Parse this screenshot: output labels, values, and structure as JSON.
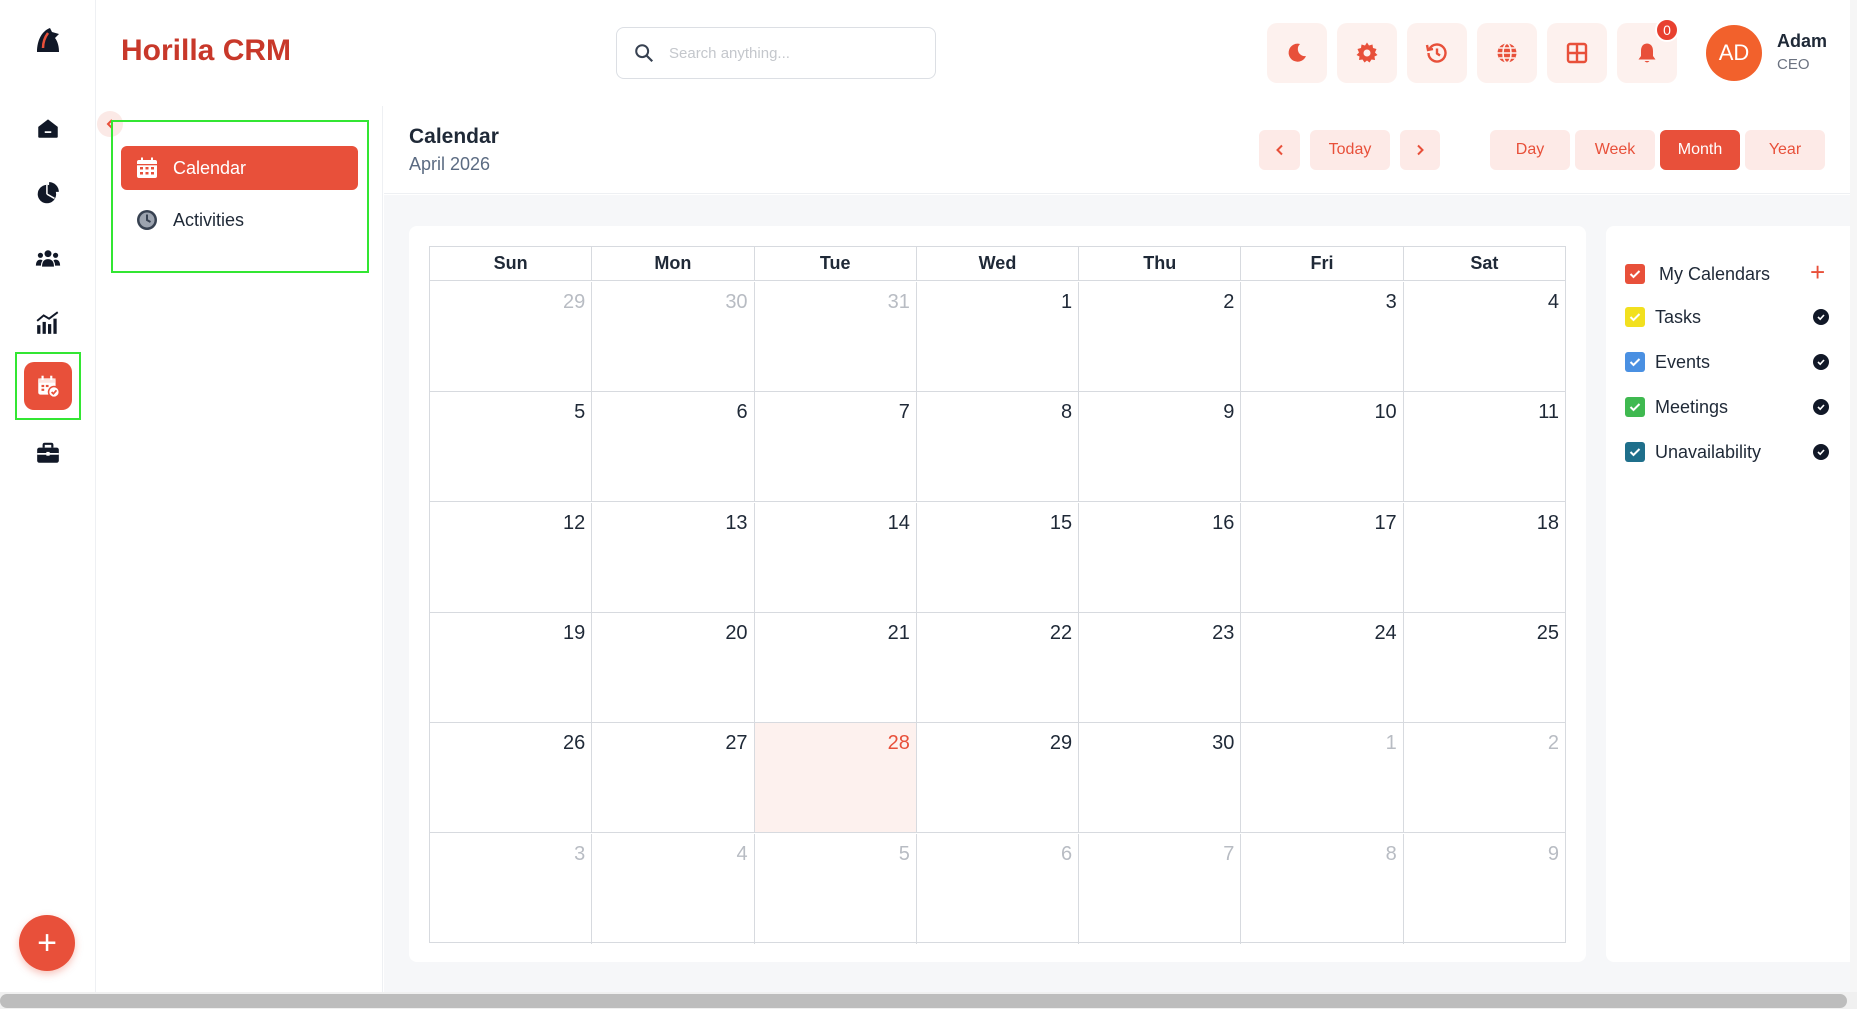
{
  "header": {
    "app_title": "Horilla CRM",
    "search_placeholder": "Search anything...",
    "notification_count": "0",
    "user": {
      "initials": "AD",
      "name": "Adam",
      "role": "CEO"
    }
  },
  "rail": {
    "items": [
      "home-icon",
      "pie-chart-icon",
      "users-icon",
      "analytics-icon",
      "calendar-check-icon",
      "briefcase-icon"
    ],
    "active": "calendar-check-icon",
    "fab_label": "+"
  },
  "subnav": {
    "items": [
      {
        "label": "Calendar",
        "icon": "calendar-icon",
        "active": true
      },
      {
        "label": "Activities",
        "icon": "clock-icon",
        "active": false
      }
    ]
  },
  "calendar": {
    "title": "Calendar",
    "subtitle": "April 2026",
    "today_label": "Today",
    "views": [
      "Day",
      "Week",
      "Month",
      "Year"
    ],
    "active_view": "Month",
    "weekdays": [
      "Sun",
      "Mon",
      "Tue",
      "Wed",
      "Thu",
      "Fri",
      "Sat"
    ],
    "weeks": [
      [
        {
          "d": "29",
          "m": true
        },
        {
          "d": "30",
          "m": true
        },
        {
          "d": "31",
          "m": true
        },
        {
          "d": "1"
        },
        {
          "d": "2"
        },
        {
          "d": "3"
        },
        {
          "d": "4"
        }
      ],
      [
        {
          "d": "5"
        },
        {
          "d": "6"
        },
        {
          "d": "7"
        },
        {
          "d": "8"
        },
        {
          "d": "9"
        },
        {
          "d": "10"
        },
        {
          "d": "11"
        }
      ],
      [
        {
          "d": "12"
        },
        {
          "d": "13"
        },
        {
          "d": "14"
        },
        {
          "d": "15"
        },
        {
          "d": "16"
        },
        {
          "d": "17"
        },
        {
          "d": "18"
        }
      ],
      [
        {
          "d": "19"
        },
        {
          "d": "20"
        },
        {
          "d": "21"
        },
        {
          "d": "22"
        },
        {
          "d": "23"
        },
        {
          "d": "24"
        },
        {
          "d": "25"
        }
      ],
      [
        {
          "d": "26"
        },
        {
          "d": "27"
        },
        {
          "d": "28",
          "t": true
        },
        {
          "d": "29"
        },
        {
          "d": "30"
        },
        {
          "d": "1",
          "m": true
        },
        {
          "d": "2",
          "m": true
        }
      ],
      [
        {
          "d": "3",
          "m": true
        },
        {
          "d": "4",
          "m": true
        },
        {
          "d": "5",
          "m": true
        },
        {
          "d": "6",
          "m": true
        },
        {
          "d": "7",
          "m": true
        },
        {
          "d": "8",
          "m": true
        },
        {
          "d": "9",
          "m": true
        }
      ]
    ]
  },
  "filters": {
    "heading": "My Calendars",
    "items": [
      {
        "label": "Tasks",
        "color": "#f2e01f"
      },
      {
        "label": "Events",
        "color": "#4a90e2"
      },
      {
        "label": "Meetings",
        "color": "#3fb950"
      },
      {
        "label": "Unavailability",
        "color": "#1f6f8b"
      }
    ],
    "heading_color": "#e8503a"
  },
  "colors": {
    "accent": "#e8503a",
    "brand_title": "#c8382a",
    "avatar": "#f2612c"
  }
}
